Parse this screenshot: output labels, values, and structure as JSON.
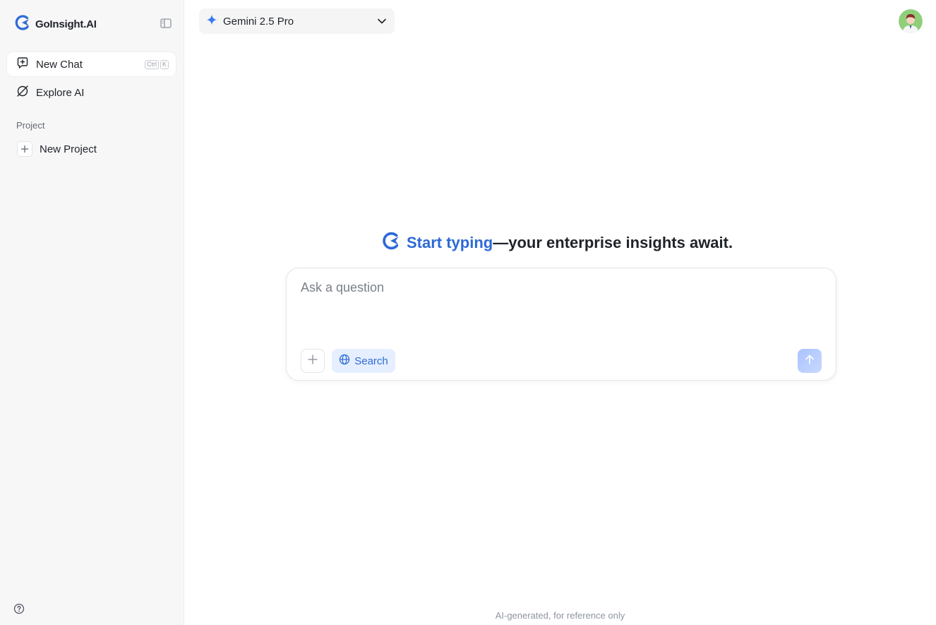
{
  "brand": {
    "name": "GoInsight.AI",
    "logo_icon": "goinsight-logo-icon",
    "accent": "#2d6ad6"
  },
  "sidebar": {
    "nav": [
      {
        "label": "New Chat",
        "icon": "new-chat-icon",
        "shortcut": [
          "Ctrl",
          "K"
        ],
        "active": true
      },
      {
        "label": "Explore AI",
        "icon": "explore-icon",
        "active": false
      }
    ],
    "project_section_label": "Project",
    "new_project_label": "New Project"
  },
  "header": {
    "model_name": "Gemini 2.5 Pro",
    "model_icon": "sparkle-icon"
  },
  "hero": {
    "accent_text": "Start typing",
    "rest_text": "—your enterprise insights await."
  },
  "composer": {
    "placeholder": "Ask a question",
    "value": "",
    "search_label": "Search"
  },
  "footer_note": "AI-generated, for reference only"
}
